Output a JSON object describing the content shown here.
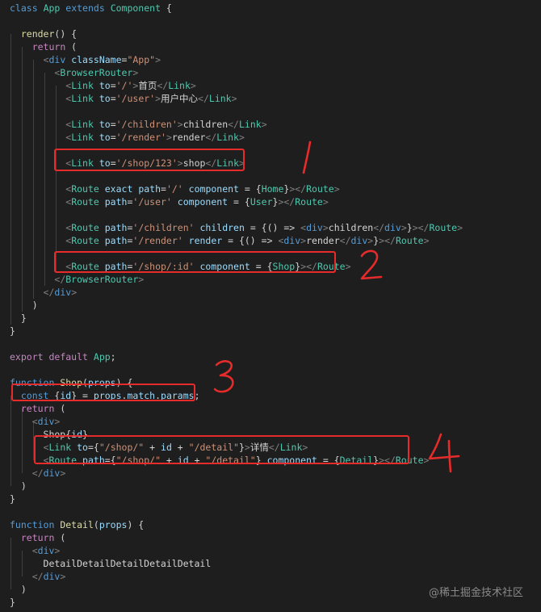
{
  "code_lines": [
    [
      [
        "kw",
        "class"
      ],
      [
        "txt",
        " "
      ],
      [
        "cls",
        "App"
      ],
      [
        "txt",
        " "
      ],
      [
        "kw",
        "extends"
      ],
      [
        "txt",
        " "
      ],
      [
        "cls",
        "Component"
      ],
      [
        "txt",
        " {"
      ]
    ],
    [],
    [
      [
        "txt",
        "  "
      ],
      [
        "fn",
        "render"
      ],
      [
        "txt",
        "() {"
      ]
    ],
    [
      [
        "txt",
        "    "
      ],
      [
        "ctl",
        "return"
      ],
      [
        "txt",
        " ("
      ]
    ],
    [
      [
        "txt",
        "      "
      ],
      [
        "pun",
        "<"
      ],
      [
        "tag",
        "div"
      ],
      [
        "txt",
        " "
      ],
      [
        "attr",
        "className"
      ],
      [
        "txt",
        "="
      ],
      [
        "str",
        "\"App\""
      ],
      [
        "pun",
        ">"
      ]
    ],
    [
      [
        "txt",
        "        "
      ],
      [
        "pun",
        "<"
      ],
      [
        "cls",
        "BrowserRouter"
      ],
      [
        "pun",
        ">"
      ]
    ],
    [
      [
        "txt",
        "          "
      ],
      [
        "pun",
        "<"
      ],
      [
        "cls",
        "Link"
      ],
      [
        "txt",
        " "
      ],
      [
        "attr",
        "to"
      ],
      [
        "txt",
        "="
      ],
      [
        "str",
        "'/'"
      ],
      [
        "pun",
        ">"
      ],
      [
        "txt",
        "首页"
      ],
      [
        "pun",
        "</"
      ],
      [
        "cls",
        "Link"
      ],
      [
        "pun",
        ">"
      ]
    ],
    [
      [
        "txt",
        "          "
      ],
      [
        "pun",
        "<"
      ],
      [
        "cls",
        "Link"
      ],
      [
        "txt",
        " "
      ],
      [
        "attr",
        "to"
      ],
      [
        "txt",
        "="
      ],
      [
        "str",
        "'/user'"
      ],
      [
        "pun",
        ">"
      ],
      [
        "txt",
        "用户中心"
      ],
      [
        "pun",
        "</"
      ],
      [
        "cls",
        "Link"
      ],
      [
        "pun",
        ">"
      ]
    ],
    [],
    [
      [
        "txt",
        "          "
      ],
      [
        "pun",
        "<"
      ],
      [
        "cls",
        "Link"
      ],
      [
        "txt",
        " "
      ],
      [
        "attr",
        "to"
      ],
      [
        "txt",
        "="
      ],
      [
        "str",
        "'/children'"
      ],
      [
        "pun",
        ">"
      ],
      [
        "txt",
        "children"
      ],
      [
        "pun",
        "</"
      ],
      [
        "cls",
        "Link"
      ],
      [
        "pun",
        ">"
      ]
    ],
    [
      [
        "txt",
        "          "
      ],
      [
        "pun",
        "<"
      ],
      [
        "cls",
        "Link"
      ],
      [
        "txt",
        " "
      ],
      [
        "attr",
        "to"
      ],
      [
        "txt",
        "="
      ],
      [
        "str",
        "'/render'"
      ],
      [
        "pun",
        ">"
      ],
      [
        "txt",
        "render"
      ],
      [
        "pun",
        "</"
      ],
      [
        "cls",
        "Link"
      ],
      [
        "pun",
        ">"
      ]
    ],
    [],
    [
      [
        "txt",
        "          "
      ],
      [
        "pun",
        "<"
      ],
      [
        "cls",
        "Link"
      ],
      [
        "txt",
        " "
      ],
      [
        "attr",
        "to"
      ],
      [
        "txt",
        "="
      ],
      [
        "str",
        "'/shop/123'"
      ],
      [
        "pun",
        ">"
      ],
      [
        "txt",
        "shop"
      ],
      [
        "pun",
        "</"
      ],
      [
        "cls",
        "Link"
      ],
      [
        "pun",
        ">"
      ]
    ],
    [],
    [
      [
        "txt",
        "          "
      ],
      [
        "pun",
        "<"
      ],
      [
        "cls",
        "Route"
      ],
      [
        "txt",
        " "
      ],
      [
        "attr",
        "exact"
      ],
      [
        "txt",
        " "
      ],
      [
        "attr",
        "path"
      ],
      [
        "txt",
        "="
      ],
      [
        "str",
        "'/'"
      ],
      [
        "txt",
        " "
      ],
      [
        "attr",
        "component"
      ],
      [
        "txt",
        " = {"
      ],
      [
        "cls",
        "Home"
      ],
      [
        "txt",
        "}"
      ],
      [
        "pun",
        "></"
      ],
      [
        "cls",
        "Route"
      ],
      [
        "pun",
        ">"
      ]
    ],
    [
      [
        "txt",
        "          "
      ],
      [
        "pun",
        "<"
      ],
      [
        "cls",
        "Route"
      ],
      [
        "txt",
        " "
      ],
      [
        "attr",
        "path"
      ],
      [
        "txt",
        "="
      ],
      [
        "str",
        "'/user'"
      ],
      [
        "txt",
        " "
      ],
      [
        "attr",
        "component"
      ],
      [
        "txt",
        " = {"
      ],
      [
        "cls",
        "User"
      ],
      [
        "txt",
        "}"
      ],
      [
        "pun",
        "></"
      ],
      [
        "cls",
        "Route"
      ],
      [
        "pun",
        ">"
      ]
    ],
    [],
    [
      [
        "txt",
        "          "
      ],
      [
        "pun",
        "<"
      ],
      [
        "cls",
        "Route"
      ],
      [
        "txt",
        " "
      ],
      [
        "attr",
        "path"
      ],
      [
        "txt",
        "="
      ],
      [
        "str",
        "'/children'"
      ],
      [
        "txt",
        " "
      ],
      [
        "attr",
        "children"
      ],
      [
        "txt",
        " = {() => "
      ],
      [
        "pun",
        "<"
      ],
      [
        "tag",
        "div"
      ],
      [
        "pun",
        ">"
      ],
      [
        "txt",
        "children"
      ],
      [
        "pun",
        "</"
      ],
      [
        "tag",
        "div"
      ],
      [
        "pun",
        ">"
      ],
      [
        "txt",
        "}"
      ],
      [
        "pun",
        "></"
      ],
      [
        "cls",
        "Route"
      ],
      [
        "pun",
        ">"
      ]
    ],
    [
      [
        "txt",
        "          "
      ],
      [
        "pun",
        "<"
      ],
      [
        "cls",
        "Route"
      ],
      [
        "txt",
        " "
      ],
      [
        "attr",
        "path"
      ],
      [
        "txt",
        "="
      ],
      [
        "str",
        "'/render'"
      ],
      [
        "txt",
        " "
      ],
      [
        "attr",
        "render"
      ],
      [
        "txt",
        " = {() => "
      ],
      [
        "pun",
        "<"
      ],
      [
        "tag",
        "div"
      ],
      [
        "pun",
        ">"
      ],
      [
        "txt",
        "render"
      ],
      [
        "pun",
        "</"
      ],
      [
        "tag",
        "div"
      ],
      [
        "pun",
        ">"
      ],
      [
        "txt",
        "}"
      ],
      [
        "pun",
        "></"
      ],
      [
        "cls",
        "Route"
      ],
      [
        "pun",
        ">"
      ]
    ],
    [],
    [
      [
        "txt",
        "          "
      ],
      [
        "pun",
        "<"
      ],
      [
        "cls",
        "Route"
      ],
      [
        "txt",
        " "
      ],
      [
        "attr",
        "path"
      ],
      [
        "txt",
        "="
      ],
      [
        "str",
        "'/shop/:id'"
      ],
      [
        "txt",
        " "
      ],
      [
        "attr",
        "component"
      ],
      [
        "txt",
        " = {"
      ],
      [
        "cls",
        "Shop"
      ],
      [
        "txt",
        "}"
      ],
      [
        "pun",
        "></"
      ],
      [
        "cls",
        "Route"
      ],
      [
        "pun",
        ">"
      ]
    ],
    [
      [
        "txt",
        "        "
      ],
      [
        "pun",
        "</"
      ],
      [
        "cls",
        "BrowserRouter"
      ],
      [
        "pun",
        ">"
      ]
    ],
    [
      [
        "txt",
        "      "
      ],
      [
        "pun",
        "</"
      ],
      [
        "tag",
        "div"
      ],
      [
        "pun",
        ">"
      ]
    ],
    [
      [
        "txt",
        "    )"
      ]
    ],
    [
      [
        "txt",
        "  }"
      ]
    ],
    [
      [
        "txt",
        "}"
      ]
    ],
    [],
    [
      [
        "ctl",
        "export"
      ],
      [
        "txt",
        " "
      ],
      [
        "ctl",
        "default"
      ],
      [
        "txt",
        " "
      ],
      [
        "cls",
        "App"
      ],
      [
        "txt",
        ";"
      ]
    ],
    [],
    [
      [
        "kw",
        "function"
      ],
      [
        "txt",
        " "
      ],
      [
        "fn",
        "Shop"
      ],
      [
        "txt",
        "("
      ],
      [
        "var",
        "props"
      ],
      [
        "txt",
        ") {"
      ]
    ],
    [
      [
        "txt",
        "  "
      ],
      [
        "kw",
        "const"
      ],
      [
        "txt",
        " {"
      ],
      [
        "var",
        "id"
      ],
      [
        "txt",
        "} = "
      ],
      [
        "var",
        "props"
      ],
      [
        "txt",
        "."
      ],
      [
        "var",
        "match"
      ],
      [
        "txt",
        "."
      ],
      [
        "var",
        "params"
      ],
      [
        "txt",
        ";"
      ]
    ],
    [
      [
        "txt",
        "  "
      ],
      [
        "ctl",
        "return"
      ],
      [
        "txt",
        " ("
      ]
    ],
    [
      [
        "txt",
        "    "
      ],
      [
        "pun",
        "<"
      ],
      [
        "tag",
        "div"
      ],
      [
        "pun",
        ">"
      ]
    ],
    [
      [
        "txt",
        "      Shop{"
      ],
      [
        "var",
        "id"
      ],
      [
        "txt",
        "}"
      ]
    ],
    [
      [
        "txt",
        "      "
      ],
      [
        "pun",
        "<"
      ],
      [
        "cls",
        "Link"
      ],
      [
        "txt",
        " "
      ],
      [
        "attr",
        "to"
      ],
      [
        "txt",
        "={"
      ],
      [
        "str",
        "\"/shop/\""
      ],
      [
        "txt",
        " + "
      ],
      [
        "var",
        "id"
      ],
      [
        "txt",
        " + "
      ],
      [
        "str",
        "\"/detail\""
      ],
      [
        "txt",
        "}"
      ],
      [
        "pun",
        ">"
      ],
      [
        "txt",
        "详情"
      ],
      [
        "pun",
        "</"
      ],
      [
        "cls",
        "Link"
      ],
      [
        "pun",
        ">"
      ]
    ],
    [
      [
        "txt",
        "      "
      ],
      [
        "pun",
        "<"
      ],
      [
        "cls",
        "Route"
      ],
      [
        "txt",
        " "
      ],
      [
        "attr",
        "path"
      ],
      [
        "txt",
        "={"
      ],
      [
        "str",
        "\"/shop/\""
      ],
      [
        "txt",
        " + "
      ],
      [
        "var",
        "id"
      ],
      [
        "txt",
        " + "
      ],
      [
        "str",
        "\"/detail\""
      ],
      [
        "txt",
        "} "
      ],
      [
        "attr",
        "component"
      ],
      [
        "txt",
        " = {"
      ],
      [
        "cls",
        "Detail"
      ],
      [
        "txt",
        "}"
      ],
      [
        "pun",
        "></"
      ],
      [
        "cls",
        "Route"
      ],
      [
        "pun",
        ">"
      ]
    ],
    [
      [
        "txt",
        "    "
      ],
      [
        "pun",
        "</"
      ],
      [
        "tag",
        "div"
      ],
      [
        "pun",
        ">"
      ]
    ],
    [
      [
        "txt",
        "  )"
      ]
    ],
    [
      [
        "txt",
        "}"
      ]
    ],
    [],
    [
      [
        "kw",
        "function"
      ],
      [
        "txt",
        " "
      ],
      [
        "fn",
        "Detail"
      ],
      [
        "txt",
        "("
      ],
      [
        "var",
        "props"
      ],
      [
        "txt",
        ") {"
      ]
    ],
    [
      [
        "txt",
        "  "
      ],
      [
        "ctl",
        "return"
      ],
      [
        "txt",
        " ("
      ]
    ],
    [
      [
        "txt",
        "    "
      ],
      [
        "pun",
        "<"
      ],
      [
        "tag",
        "div"
      ],
      [
        "pun",
        ">"
      ]
    ],
    [
      [
        "txt",
        "      DetailDetailDetailDetailDetail"
      ]
    ],
    [
      [
        "txt",
        "    "
      ],
      [
        "pun",
        "</"
      ],
      [
        "tag",
        "div"
      ],
      [
        "pun",
        ">"
      ]
    ],
    [
      [
        "txt",
        "  )"
      ]
    ],
    [
      [
        "txt",
        "}"
      ]
    ]
  ],
  "annotations": {
    "one": "1",
    "two": "2",
    "three": "3",
    "four": "4"
  },
  "watermark": "@稀土掘金技术社区",
  "colors": {
    "background": "#1e1e1e",
    "annotation_red": "#e62b2b"
  }
}
